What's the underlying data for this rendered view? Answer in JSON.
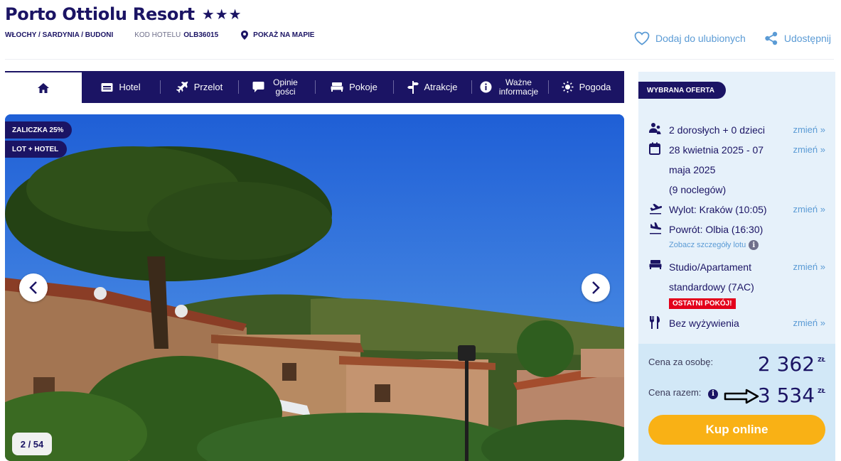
{
  "header": {
    "title": "Porto Ottiolu Resort",
    "stars": "★★★",
    "location": "WŁOCHY / SARDYNIA / BUDONI",
    "kod_label": "KOD HOTELU",
    "kod_value": "OLB36015",
    "map_label": "POKAŻ NA MAPIE",
    "favorite_label": "Dodaj do ulubionych",
    "share_label": "Udostępnij"
  },
  "tabs": {
    "hotel": "Hotel",
    "flight": "Przelot",
    "reviews": "Opinie gości",
    "rooms": "Pokoje",
    "attractions": "Atrakcje",
    "info": "Ważne informacje",
    "weather": "Pogoda"
  },
  "gallery": {
    "badge_deposit": "ZALICZKA 25%",
    "badge_type": "LOT + HOTEL",
    "counter": "2 / 54"
  },
  "offer": {
    "badge": "WYBRANA OFERTA",
    "guests": "2 dorosłych + 0 dzieci",
    "dates_line1": "28 kwietnia 2025 - 07",
    "dates_line2": "maja 2025",
    "dates_line3": "(9 noclegów)",
    "departure": "Wylot: Kraków (10:05)",
    "return": "Powrót: Olbia (16:30)",
    "flight_details": "Zobacz szczegóły lotu",
    "room_line1": "Studio/Apartament",
    "room_line2": "standardowy (7AC)",
    "last_room": "OSTATNI POKÓJ!",
    "board": "Bez wyżywienia",
    "change_label": "zmień »",
    "price_per_person_label": "Cena za osobę:",
    "price_per_person": "2 362",
    "price_total_label": "Cena razem:",
    "price_total": "3 534",
    "currency": "ZŁ",
    "buy_label": "Kup online"
  },
  "colors": {
    "brand": "#1b1464",
    "accent": "#5b9bd5",
    "buy": "#f9b115",
    "alert": "#e3001b"
  }
}
